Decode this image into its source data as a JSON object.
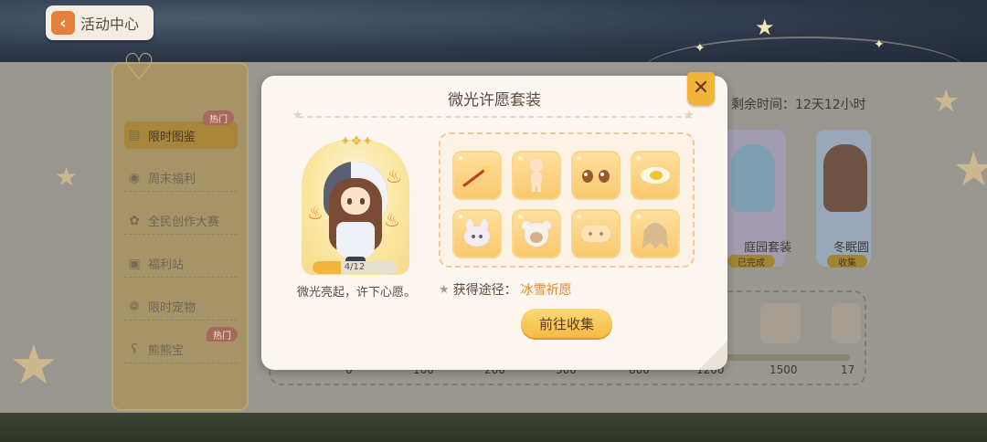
{
  "header": {
    "back_label": "活动中心",
    "back_icon": "chevron-left-icon"
  },
  "sidebar": {
    "items": [
      {
        "label": "限时图鉴",
        "icon": "book-icon",
        "hot": "热门"
      },
      {
        "label": "周末福利",
        "icon": "gift-circle-icon"
      },
      {
        "label": "全民创作大赛",
        "icon": "palette-icon"
      },
      {
        "label": "福利站",
        "icon": "box-icon"
      },
      {
        "label": "限时宠物",
        "icon": "paw-icon"
      },
      {
        "label": "熊熊宝",
        "icon": "bear-icon",
        "hot": "热门"
      }
    ]
  },
  "background": {
    "remain_time": "剩余时间：12天12小时",
    "cards": [
      {
        "name": "庭园套装",
        "tag": "已完成"
      },
      {
        "name": "冬眠圆",
        "tag": "收集"
      }
    ],
    "track_labels": [
      "0",
      "100",
      "200",
      "500",
      "800",
      "1200",
      "1500",
      "17"
    ]
  },
  "modal": {
    "title": "微光许愿套装",
    "close_icon": "close-icon",
    "progress": {
      "current": 4,
      "total": 12,
      "text": "4/12"
    },
    "slogan": "微光亮起，许下心愿。",
    "items": [
      {
        "name": "sparkler-wand-icon"
      },
      {
        "name": "doll-body-icon"
      },
      {
        "name": "eyes-icon"
      },
      {
        "name": "mouth-icon"
      },
      {
        "name": "bunny-bag-icon"
      },
      {
        "name": "bear-hood-icon"
      },
      {
        "name": "bread-scarf-icon"
      },
      {
        "name": "long-hair-icon"
      }
    ],
    "source_label": "获得途径：",
    "source_value": "冰雪祈愿",
    "go_button": "前往收集"
  },
  "colors": {
    "accent": "#f4bb43",
    "source_value": "#e0882c",
    "close_button": "#f2b53a"
  }
}
